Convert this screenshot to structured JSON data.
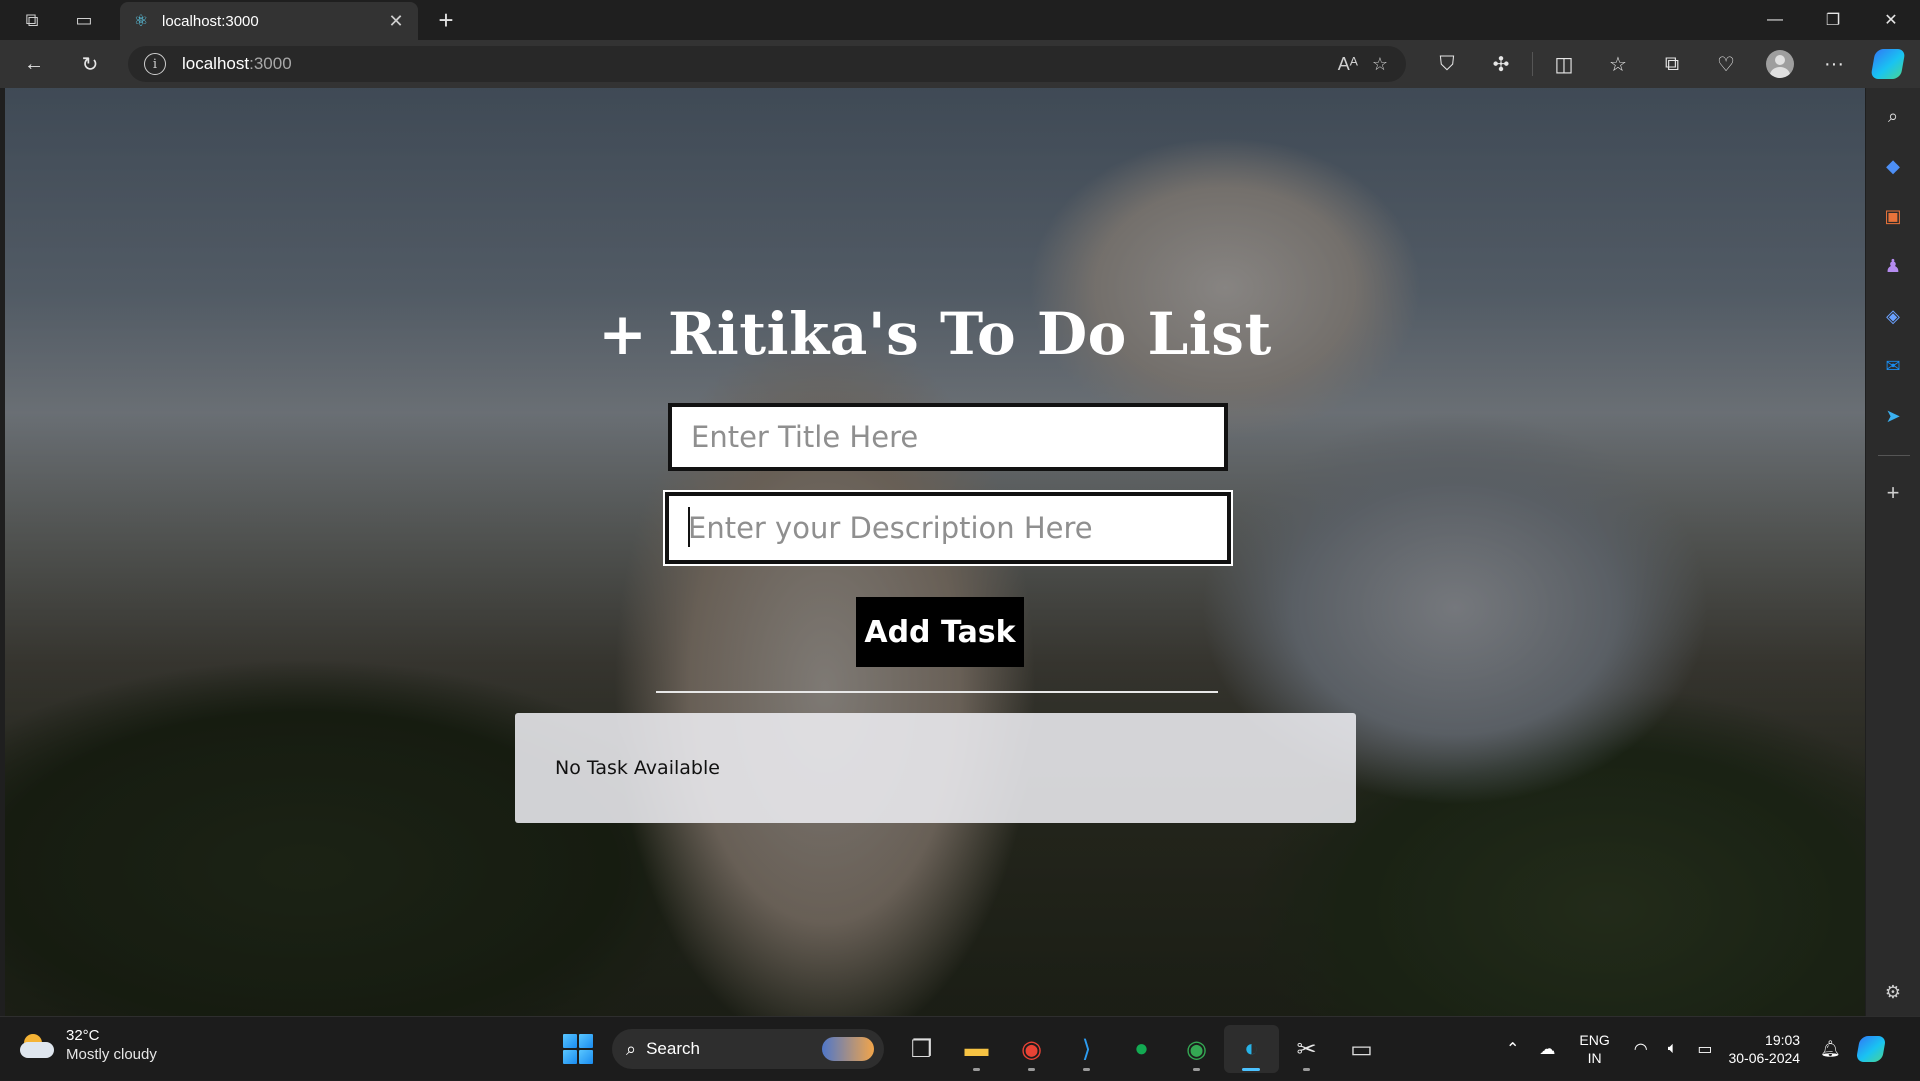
{
  "browser": {
    "tab": {
      "title": "localhost:3000",
      "favicon": "react-icon"
    },
    "address": {
      "host": "localhost",
      "port": ":3000"
    }
  },
  "app": {
    "title": "+ Ritika's To Do List",
    "title_placeholder": "Enter Title Here",
    "title_value": "",
    "description_placeholder": "Enter your Description Here",
    "description_value": "",
    "add_button": "Add Task",
    "empty_message": "No Task Available"
  },
  "taskbar": {
    "weather": {
      "temp": "32°C",
      "condition": "Mostly cloudy"
    },
    "search_label": "Search",
    "language": {
      "lang": "ENG",
      "region": "IN"
    },
    "clock": {
      "time": "19:03",
      "date": "30-06-2024"
    }
  },
  "colors": {
    "button_bg": "#000000",
    "panel_bg": "#ececf0",
    "accent": "#4cc2ff"
  }
}
